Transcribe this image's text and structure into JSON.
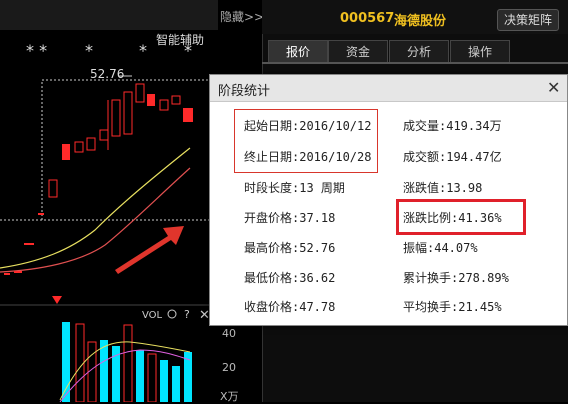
{
  "left_panel": {
    "hide_label": "隐藏>>",
    "assist_label": "智能辅助",
    "price_marker": "52.76",
    "vol_label": "VOL",
    "axis_value_40": "40",
    "axis_value_20": "20",
    "axis_unit": "X万"
  },
  "header": {
    "stock_code": "000567",
    "stock_name": "海德股份",
    "decision_button": "决策矩阵"
  },
  "tabs": [
    {
      "label": "报价",
      "active": true
    },
    {
      "label": "资金",
      "active": false
    },
    {
      "label": "分析",
      "active": false
    },
    {
      "label": "操作",
      "active": false
    }
  ],
  "dialog": {
    "title": "阶段统计",
    "left_stats": [
      "起始日期:2016/10/12",
      "终止日期:2016/10/28",
      "时段长度:13 周期",
      "开盘价格:37.18",
      "最高价格:52.76",
      "最低价格:36.62",
      "收盘价格:47.78"
    ],
    "right_stats": [
      "成交量:419.34万",
      "成交额:194.47亿",
      "涨跌值:13.98",
      "涨跌比例:41.36%",
      "振幅:44.07%",
      "累计换手:278.89%",
      "平均换手:21.45%"
    ]
  },
  "colors": {
    "up_red": "#ff2a2a",
    "down_cyan": "#00e5ff",
    "highlight_red": "#e0202a",
    "stock_yellow": "#f0c020"
  }
}
